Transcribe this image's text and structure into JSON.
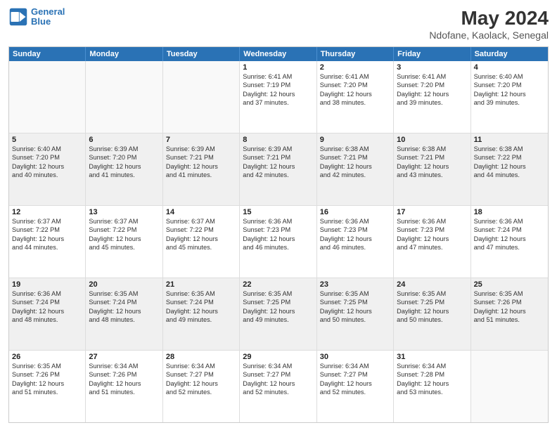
{
  "logo": {
    "line1": "General",
    "line2": "Blue"
  },
  "title": "May 2024",
  "subtitle": "Ndofane, Kaolack, Senegal",
  "header_days": [
    "Sunday",
    "Monday",
    "Tuesday",
    "Wednesday",
    "Thursday",
    "Friday",
    "Saturday"
  ],
  "rows": [
    [
      {
        "day": "",
        "lines": [],
        "empty": true
      },
      {
        "day": "",
        "lines": [],
        "empty": true
      },
      {
        "day": "",
        "lines": [],
        "empty": true
      },
      {
        "day": "1",
        "lines": [
          "Sunrise: 6:41 AM",
          "Sunset: 7:19 PM",
          "Daylight: 12 hours",
          "and 37 minutes."
        ],
        "empty": false
      },
      {
        "day": "2",
        "lines": [
          "Sunrise: 6:41 AM",
          "Sunset: 7:20 PM",
          "Daylight: 12 hours",
          "and 38 minutes."
        ],
        "empty": false
      },
      {
        "day": "3",
        "lines": [
          "Sunrise: 6:41 AM",
          "Sunset: 7:20 PM",
          "Daylight: 12 hours",
          "and 39 minutes."
        ],
        "empty": false
      },
      {
        "day": "4",
        "lines": [
          "Sunrise: 6:40 AM",
          "Sunset: 7:20 PM",
          "Daylight: 12 hours",
          "and 39 minutes."
        ],
        "empty": false
      }
    ],
    [
      {
        "day": "5",
        "lines": [
          "Sunrise: 6:40 AM",
          "Sunset: 7:20 PM",
          "Daylight: 12 hours",
          "and 40 minutes."
        ],
        "empty": false
      },
      {
        "day": "6",
        "lines": [
          "Sunrise: 6:39 AM",
          "Sunset: 7:20 PM",
          "Daylight: 12 hours",
          "and 41 minutes."
        ],
        "empty": false
      },
      {
        "day": "7",
        "lines": [
          "Sunrise: 6:39 AM",
          "Sunset: 7:21 PM",
          "Daylight: 12 hours",
          "and 41 minutes."
        ],
        "empty": false
      },
      {
        "day": "8",
        "lines": [
          "Sunrise: 6:39 AM",
          "Sunset: 7:21 PM",
          "Daylight: 12 hours",
          "and 42 minutes."
        ],
        "empty": false
      },
      {
        "day": "9",
        "lines": [
          "Sunrise: 6:38 AM",
          "Sunset: 7:21 PM",
          "Daylight: 12 hours",
          "and 42 minutes."
        ],
        "empty": false
      },
      {
        "day": "10",
        "lines": [
          "Sunrise: 6:38 AM",
          "Sunset: 7:21 PM",
          "Daylight: 12 hours",
          "and 43 minutes."
        ],
        "empty": false
      },
      {
        "day": "11",
        "lines": [
          "Sunrise: 6:38 AM",
          "Sunset: 7:22 PM",
          "Daylight: 12 hours",
          "and 44 minutes."
        ],
        "empty": false
      }
    ],
    [
      {
        "day": "12",
        "lines": [
          "Sunrise: 6:37 AM",
          "Sunset: 7:22 PM",
          "Daylight: 12 hours",
          "and 44 minutes."
        ],
        "empty": false
      },
      {
        "day": "13",
        "lines": [
          "Sunrise: 6:37 AM",
          "Sunset: 7:22 PM",
          "Daylight: 12 hours",
          "and 45 minutes."
        ],
        "empty": false
      },
      {
        "day": "14",
        "lines": [
          "Sunrise: 6:37 AM",
          "Sunset: 7:22 PM",
          "Daylight: 12 hours",
          "and 45 minutes."
        ],
        "empty": false
      },
      {
        "day": "15",
        "lines": [
          "Sunrise: 6:36 AM",
          "Sunset: 7:23 PM",
          "Daylight: 12 hours",
          "and 46 minutes."
        ],
        "empty": false
      },
      {
        "day": "16",
        "lines": [
          "Sunrise: 6:36 AM",
          "Sunset: 7:23 PM",
          "Daylight: 12 hours",
          "and 46 minutes."
        ],
        "empty": false
      },
      {
        "day": "17",
        "lines": [
          "Sunrise: 6:36 AM",
          "Sunset: 7:23 PM",
          "Daylight: 12 hours",
          "and 47 minutes."
        ],
        "empty": false
      },
      {
        "day": "18",
        "lines": [
          "Sunrise: 6:36 AM",
          "Sunset: 7:24 PM",
          "Daylight: 12 hours",
          "and 47 minutes."
        ],
        "empty": false
      }
    ],
    [
      {
        "day": "19",
        "lines": [
          "Sunrise: 6:36 AM",
          "Sunset: 7:24 PM",
          "Daylight: 12 hours",
          "and 48 minutes."
        ],
        "empty": false
      },
      {
        "day": "20",
        "lines": [
          "Sunrise: 6:35 AM",
          "Sunset: 7:24 PM",
          "Daylight: 12 hours",
          "and 48 minutes."
        ],
        "empty": false
      },
      {
        "day": "21",
        "lines": [
          "Sunrise: 6:35 AM",
          "Sunset: 7:24 PM",
          "Daylight: 12 hours",
          "and 49 minutes."
        ],
        "empty": false
      },
      {
        "day": "22",
        "lines": [
          "Sunrise: 6:35 AM",
          "Sunset: 7:25 PM",
          "Daylight: 12 hours",
          "and 49 minutes."
        ],
        "empty": false
      },
      {
        "day": "23",
        "lines": [
          "Sunrise: 6:35 AM",
          "Sunset: 7:25 PM",
          "Daylight: 12 hours",
          "and 50 minutes."
        ],
        "empty": false
      },
      {
        "day": "24",
        "lines": [
          "Sunrise: 6:35 AM",
          "Sunset: 7:25 PM",
          "Daylight: 12 hours",
          "and 50 minutes."
        ],
        "empty": false
      },
      {
        "day": "25",
        "lines": [
          "Sunrise: 6:35 AM",
          "Sunset: 7:26 PM",
          "Daylight: 12 hours",
          "and 51 minutes."
        ],
        "empty": false
      }
    ],
    [
      {
        "day": "26",
        "lines": [
          "Sunrise: 6:35 AM",
          "Sunset: 7:26 PM",
          "Daylight: 12 hours",
          "and 51 minutes."
        ],
        "empty": false
      },
      {
        "day": "27",
        "lines": [
          "Sunrise: 6:34 AM",
          "Sunset: 7:26 PM",
          "Daylight: 12 hours",
          "and 51 minutes."
        ],
        "empty": false
      },
      {
        "day": "28",
        "lines": [
          "Sunrise: 6:34 AM",
          "Sunset: 7:27 PM",
          "Daylight: 12 hours",
          "and 52 minutes."
        ],
        "empty": false
      },
      {
        "day": "29",
        "lines": [
          "Sunrise: 6:34 AM",
          "Sunset: 7:27 PM",
          "Daylight: 12 hours",
          "and 52 minutes."
        ],
        "empty": false
      },
      {
        "day": "30",
        "lines": [
          "Sunrise: 6:34 AM",
          "Sunset: 7:27 PM",
          "Daylight: 12 hours",
          "and 52 minutes."
        ],
        "empty": false
      },
      {
        "day": "31",
        "lines": [
          "Sunrise: 6:34 AM",
          "Sunset: 7:28 PM",
          "Daylight: 12 hours",
          "and 53 minutes."
        ],
        "empty": false
      },
      {
        "day": "",
        "lines": [],
        "empty": true
      }
    ]
  ]
}
